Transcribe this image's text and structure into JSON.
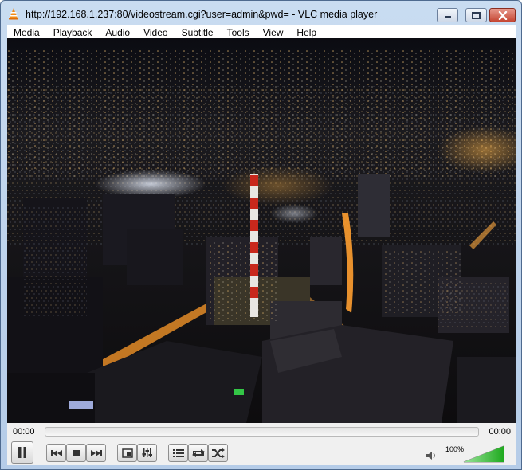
{
  "window": {
    "title": "http://192.168.1.237:80/videostream.cgi?user=admin&pwd= - VLC media player",
    "icon": "vlc-cone-icon"
  },
  "menu": [
    "Media",
    "Playback",
    "Audio",
    "Video",
    "Subtitle",
    "Tools",
    "View",
    "Help"
  ],
  "controls": {
    "elapsed": "00:00",
    "total": "00:00",
    "volume_label": "100%",
    "volume_level": 1.0,
    "seek_progress": 0,
    "buttons": [
      "pause-icon",
      "previous-icon",
      "stop-icon",
      "next-icon",
      "fullscreen-icon",
      "extended-settings-icon",
      "playlist-icon",
      "loop-icon",
      "shuffle-icon",
      "speaker-icon"
    ]
  },
  "colors": {
    "title_bar": "#c9dcf1",
    "close_button": "#c54532",
    "volume_fill": "#2db52d"
  }
}
